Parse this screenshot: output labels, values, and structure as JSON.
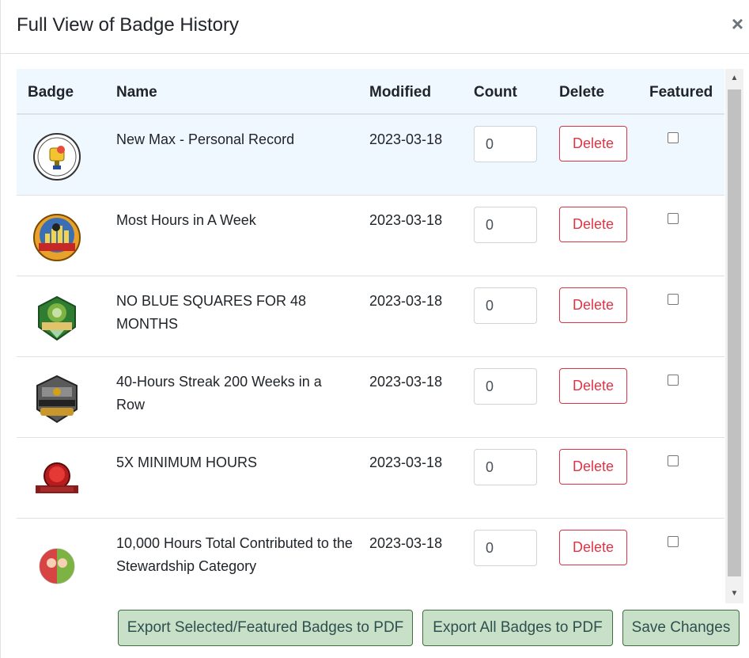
{
  "modal": {
    "title": "Full View of Badge History",
    "close_glyph": "×"
  },
  "table": {
    "headers": {
      "badge": "Badge",
      "name": "Name",
      "modified": "Modified",
      "count": "Count",
      "delete": "Delete",
      "featured": "Featured"
    },
    "rows": [
      {
        "name": "New Max - Personal Record",
        "modified": "2023-03-18",
        "count": "0",
        "delete_label": "Delete",
        "featured": false,
        "icon": "personal-record-badge-icon"
      },
      {
        "name": "Most Hours in A Week",
        "modified": "2023-03-18",
        "count": "0",
        "delete_label": "Delete",
        "featured": false,
        "icon": "most-hours-badge-icon"
      },
      {
        "name": "NO BLUE SQUARES FOR 48 MONTHS",
        "modified": "2023-03-18",
        "count": "0",
        "delete_label": "Delete",
        "featured": false,
        "icon": "no-blue-squares-badge-icon"
      },
      {
        "name": "40-Hours Streak 200 Weeks in a Row",
        "modified": "2023-03-18",
        "count": "0",
        "delete_label": "Delete",
        "featured": false,
        "icon": "hours-streak-badge-icon"
      },
      {
        "name": "5X MINIMUM HOURS",
        "modified": "2023-03-18",
        "count": "0",
        "delete_label": "Delete",
        "featured": false,
        "icon": "minimum-hours-badge-icon"
      },
      {
        "name": "10,000 Hours Total Contributed to the Stewardship Category",
        "modified": "2023-03-18",
        "count": "0",
        "delete_label": "Delete",
        "featured": false,
        "icon": "stewardship-badge-icon"
      }
    ]
  },
  "footer": {
    "export_selected": "Export Selected/Featured Badges to PDF",
    "export_all": "Export All Badges to PDF",
    "save": "Save Changes"
  },
  "colors": {
    "header_bg": "#eff7ff",
    "delete_red": "#dc3545",
    "footer_btn_bg": "#c8e0c8"
  }
}
